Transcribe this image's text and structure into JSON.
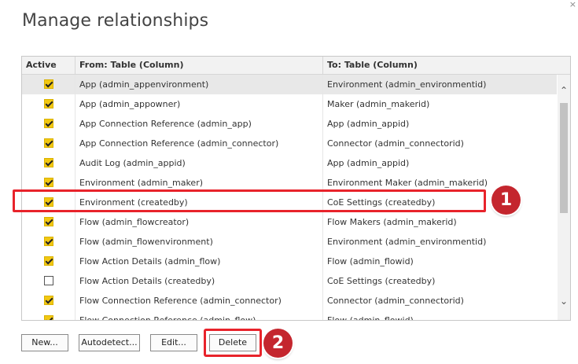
{
  "dialog": {
    "title": "Manage relationships",
    "close_glyph": "×"
  },
  "table": {
    "columns": [
      "Active",
      "From: Table (Column)",
      "To: Table (Column)"
    ],
    "rows": [
      {
        "active": true,
        "from": "App (admin_appenvironment)",
        "to": "Environment (admin_environmentid)",
        "selected": true
      },
      {
        "active": true,
        "from": "App (admin_appowner)",
        "to": "Maker (admin_makerid)"
      },
      {
        "active": true,
        "from": "App Connection Reference (admin_app)",
        "to": "App (admin_appid)"
      },
      {
        "active": true,
        "from": "App Connection Reference (admin_connector)",
        "to": "Connector (admin_connectorid)"
      },
      {
        "active": true,
        "from": "Audit Log (admin_appid)",
        "to": "App (admin_appid)"
      },
      {
        "active": true,
        "from": "Environment (admin_maker)",
        "to": "Environment Maker (admin_makerid)"
      },
      {
        "active": true,
        "from": "Environment (createdby)",
        "to": "CoE Settings (createdby)",
        "highlighted": true
      },
      {
        "active": true,
        "from": "Flow (admin_flowcreator)",
        "to": "Flow Makers (admin_makerid)"
      },
      {
        "active": true,
        "from": "Flow (admin_flowenvironment)",
        "to": "Environment (admin_environmentid)"
      },
      {
        "active": true,
        "from": "Flow Action Details (admin_flow)",
        "to": "Flow (admin_flowid)"
      },
      {
        "active": false,
        "from": "Flow Action Details (createdby)",
        "to": "CoE Settings (createdby)"
      },
      {
        "active": true,
        "from": "Flow Connection Reference (admin_connector)",
        "to": "Connector (admin_connectorid)"
      },
      {
        "active": true,
        "from": "Flow Connection Reference (admin_flow)",
        "to": "Flow (admin_flowid)",
        "partial": true
      }
    ]
  },
  "scrollbar": {
    "up_glyph": "⌃",
    "down_glyph": "⌄"
  },
  "buttons": {
    "new_label": "New...",
    "autodetect_label": "Autodetect...",
    "edit_label": "Edit...",
    "delete_label": "Delete"
  },
  "annotations": {
    "step1": "1",
    "step2": "2",
    "color": "#c4262e",
    "highlight_color": "#e8232b"
  },
  "colors": {
    "checkbox_checked": "#f2c811",
    "header_bg": "#f2f2f2",
    "selected_row_bg": "#e8e8e8"
  }
}
